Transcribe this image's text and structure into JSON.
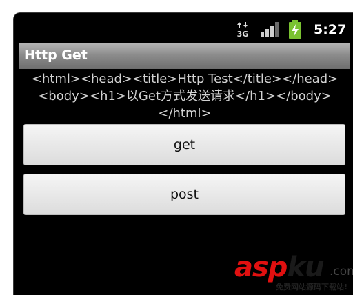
{
  "status_bar": {
    "network_icon": "3g-data-icon",
    "network_label": "3G",
    "signal_icon": "signal-strength-icon",
    "battery_icon": "battery-charging-icon",
    "time": "5:27"
  },
  "app": {
    "title": "Http Get",
    "response_text": "<html><head><title>Http Test</title></head><body><h1>以Get方式发送请求</h1></body></html>"
  },
  "buttons": {
    "get_label": "get",
    "post_label": "post"
  },
  "watermark": {
    "asp": "asp",
    "ku": "ku",
    "com": ".com",
    "sub": "免费网站源码下载站!"
  },
  "colors": {
    "background": "#000000",
    "titlebar": "#8c8c8c",
    "battery": "#7ac231",
    "watermark_red": "#e01010"
  }
}
